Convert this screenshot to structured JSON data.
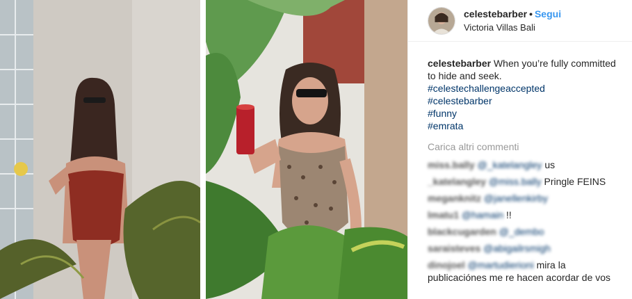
{
  "header": {
    "username": "celestebarber",
    "separator": "•",
    "follow_label": "Segui",
    "location": "Victoria Villas Bali"
  },
  "caption": {
    "username": "celestebarber",
    "text": "When you’re fully committed to hide and seek.",
    "hashtags": [
      "#celestechallengeaccepted",
      "#celestebarber",
      "#funny",
      "#emrata"
    ]
  },
  "load_more_label": "Carica altri commenti",
  "comments": [
    {
      "user": "miss.bally",
      "mention": "@_katelangley",
      "text": "us"
    },
    {
      "user": "_katelangley",
      "mention": "@miss.bally",
      "text": "Pringle FEINS"
    },
    {
      "user": "meganknitz",
      "mention": "@janellenkirby",
      "text": ""
    },
    {
      "user": "lmatu1",
      "mention": "@hamain",
      "text": "!!"
    },
    {
      "user": "blackcugarden",
      "mention": "@_dembo",
      "text": ""
    },
    {
      "user": "saraisteves",
      "mention": "@abigailrsmigh",
      "text": ""
    },
    {
      "user": "dinojoel",
      "mention": "@martudierioni",
      "text": "mira la publicaciónes me re hacen acordar de vos"
    }
  ],
  "colors": {
    "link": "#3897f0",
    "hashtag": "#003569",
    "muted": "#999999",
    "text": "#262626"
  }
}
